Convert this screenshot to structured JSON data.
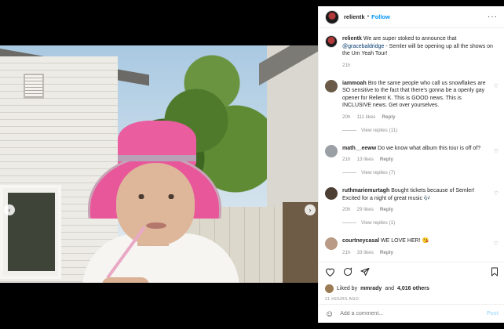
{
  "post": {
    "username": "relientk",
    "follow_label": "Follow",
    "more_icon": "more-horizontal-icon",
    "caption_user": "relientk",
    "caption_text_1": "We are super stoked to announce that",
    "caption_mention": "@gracebaldridge",
    "caption_text_2": "- Semler will be opening up all the shows on the Um Yeah Tour!",
    "caption_time": "21h"
  },
  "comments": [
    {
      "user": "iammoah",
      "text": "Bro the same people who call us snowflakes are SO sensitive to the fact that there's gonna be a openly gay opener for Relient K. This is GOOD news. This is INCLUSIVE news. Get over yourselves.",
      "time": "20h",
      "likes": "111 likes",
      "reply": "Reply",
      "view_replies": "View replies (11)",
      "avatar_color": "#6a5a47"
    },
    {
      "user": "math__eeww",
      "text": "Do we know what album this tour is off of?",
      "time": "21h",
      "likes": "13 likes",
      "reply": "Reply",
      "view_replies": "View replies (7)",
      "avatar_color": "#9aa0a6"
    },
    {
      "user": "ruthmariemurtagh",
      "text": "Bought tickets because of Semler! Excited for a night of great music 🎶",
      "time": "20h",
      "likes": "29 likes",
      "reply": "Reply",
      "view_replies": "View replies (1)",
      "avatar_color": "#4d3e33"
    },
    {
      "user": "courtneycasal",
      "text": "WE LOVE HER! 😘",
      "time": "21h",
      "likes": "33 likes",
      "reply": "Reply",
      "view_replies": "View replies (2)",
      "avatar_color": "#b89a86"
    }
  ],
  "actions": {
    "heart_icon": "heart-icon",
    "comment_icon": "comment-icon",
    "share_icon": "share-icon",
    "bookmark_icon": "bookmark-icon",
    "liked_by_prefix": "Liked by",
    "liked_by_user": "mmrady",
    "liked_by_and": "and",
    "liked_by_count": "4,016 others",
    "posted_time": "21 HOURS AGO"
  },
  "add_comment": {
    "placeholder": "Add a comment...",
    "post_label": "Post"
  }
}
